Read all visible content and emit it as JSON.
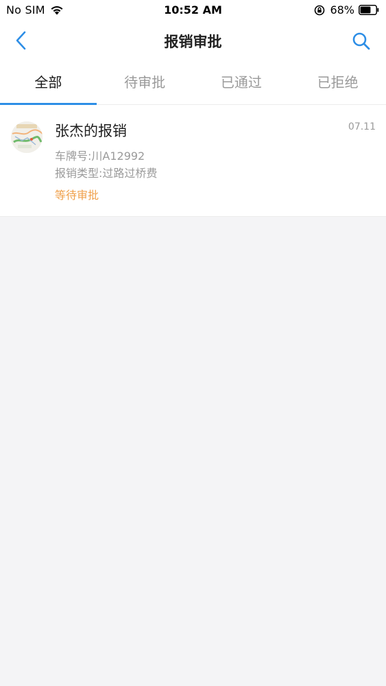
{
  "status_bar": {
    "carrier": "No SIM",
    "time": "10:52 AM",
    "battery_percent_label": "68%",
    "battery_level": 0.68,
    "icons": [
      "wifi-icon",
      "rotation-lock-icon",
      "battery-icon"
    ]
  },
  "nav": {
    "title": "报销审批",
    "back_icon": "chevron-left-icon",
    "search_icon": "search-icon"
  },
  "tabs": [
    {
      "label": "全部",
      "active": true
    },
    {
      "label": "待审批",
      "active": false
    },
    {
      "label": "已通过",
      "active": false
    },
    {
      "label": "已拒绝",
      "active": false
    }
  ],
  "list": {
    "items": [
      {
        "title": "张杰的报销",
        "date": "07.11",
        "plate": "车牌号:川A12992",
        "type": "报销类型:过路过桥费",
        "status": "等待审批"
      }
    ]
  },
  "colors": {
    "accent": "#2d8ee6",
    "status_pending": "#f0a04b",
    "background": "#f4f4f6",
    "muted_text": "#9a9a9a"
  }
}
